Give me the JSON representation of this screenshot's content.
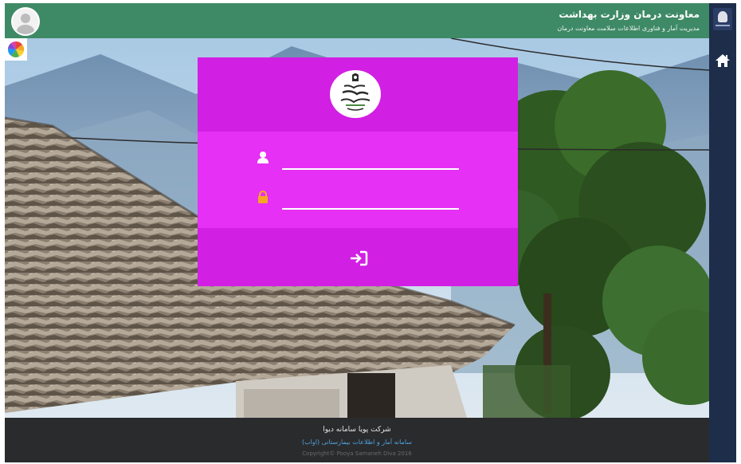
{
  "header": {
    "title": "معاونت درمان وزارت بهداشت",
    "subtitle": "مدیریت آمار و فناوری اطلاعات سلامت معاونت درمان"
  },
  "login": {
    "username_value": "",
    "password_value": ""
  },
  "footer": {
    "company": "شرکت پویا سامانه دیوا",
    "system": "سامانه آمار و اطلاعات بیمارستانی (اواب)",
    "copyright": "Copyright© Pooya Samaneh Diva 2016"
  },
  "icons": {
    "avatar": "user-avatar-icon",
    "sidebar_logo": "ministry-logo-icon",
    "home": "home-icon",
    "app_launcher": "colorful-app-icon",
    "card_logo": "ministry-emblem",
    "username": "user-icon",
    "password": "lock-icon",
    "login": "sign-in-icon"
  },
  "colors": {
    "header": "#3f8a66",
    "sidebar": "#1e2d4a",
    "card_primary": "#d21fe4",
    "card_secondary": "#e630f5",
    "footer": "#2a2b2d",
    "footer_link": "#4fa3e0",
    "lock_icon": "#f5a623"
  }
}
